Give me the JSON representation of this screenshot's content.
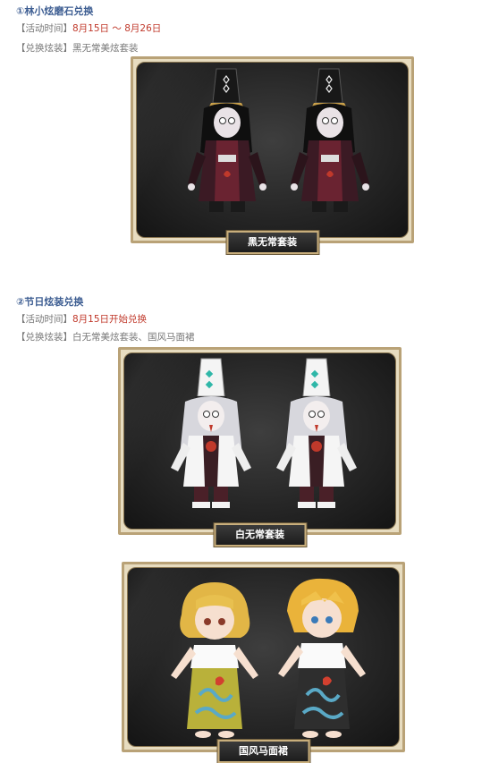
{
  "section1": {
    "title": "①林小炫磨石兑换",
    "time_label": "【活动时间】",
    "time_value": "8月15日 ～ 8月26日",
    "outfit_label": "【兑换炫装】",
    "outfit_value": "黑无常美炫套装",
    "image_caption": "黑无常套装"
  },
  "section2": {
    "title": "②节日炫装兑换",
    "time_label": "【活动时间】",
    "time_value": "8月15日开始兑换",
    "outfit_label": "【兑换炫装】",
    "outfit_value": "白无常美炫套装、国风马面裙",
    "image1_caption": "白无常套装",
    "image2_caption": "国风马面裙"
  },
  "colors": {
    "title_blue": "#3f5f93",
    "highlight_red": "#c0392b",
    "frame_gold": "#b9a277"
  }
}
